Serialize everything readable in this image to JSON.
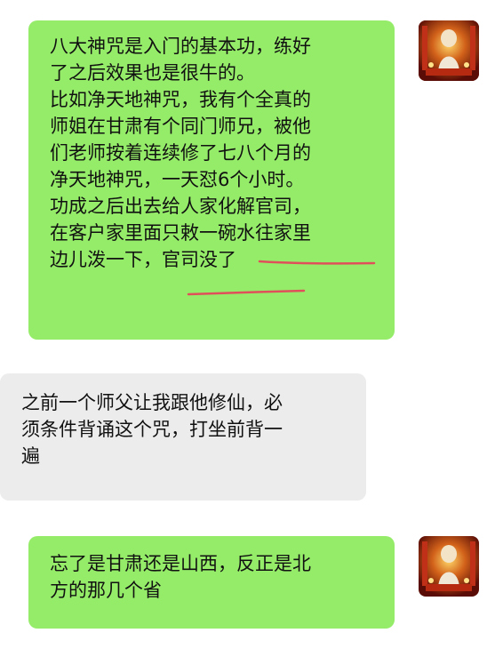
{
  "messages": [
    {
      "side": "outgoing",
      "lines": [
        "八大神咒是入门的基本功，练好",
        "了之后效果也是很牛的。",
        "比如净天地神咒，我有个全真的",
        "师姐在甘肃有个同门师兄，被他",
        "们老师按着连续修了七八个月的",
        "净天地神咒，一天怼6个小时。",
        "功成之后出去给人家化解官司，",
        "在客户家里面只敕一碗水往家里",
        "边儿泼一下，官司没了"
      ]
    },
    {
      "side": "incoming",
      "lines": [
        "之前一个师父让我跟他修仙，必",
        "须条件背诵这个咒，打坐前背一",
        "遍"
      ]
    },
    {
      "side": "outgoing",
      "lines": [
        "忘了是甘肃还是山西，反正是北",
        "方的那几个省"
      ]
    }
  ],
  "colors": {
    "outgoing_bubble": "#95ec69",
    "incoming_bubble": "#ececec",
    "annotation_underline": "#e0505a"
  },
  "avatar_icon": "deity-statue-avatar"
}
